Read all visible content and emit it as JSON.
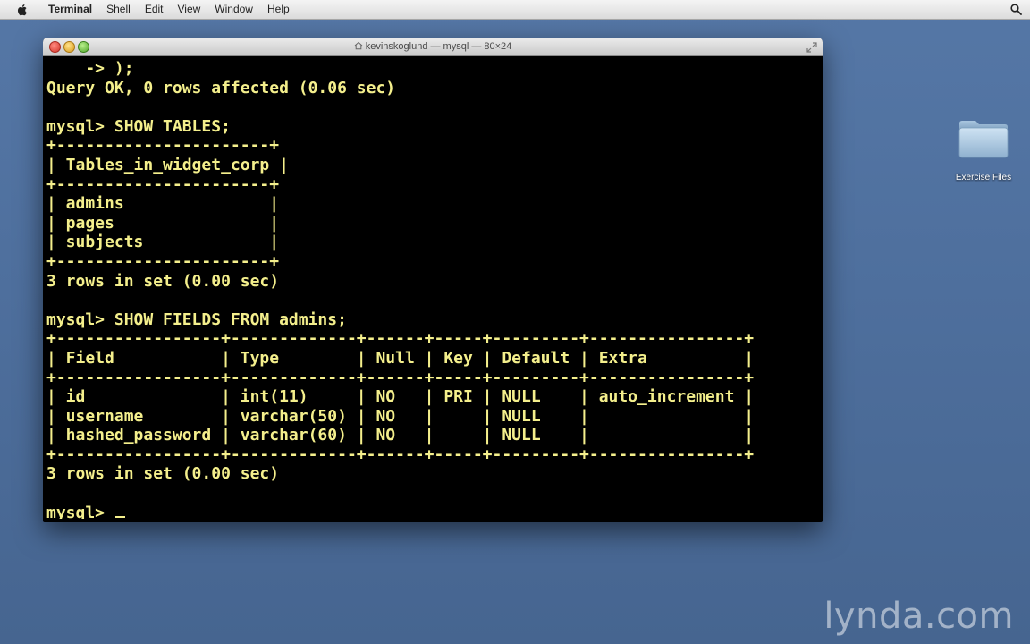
{
  "menubar": {
    "app": "Terminal",
    "items": [
      "Shell",
      "Edit",
      "View",
      "Window",
      "Help"
    ]
  },
  "window": {
    "title": "kevinskoglund — mysql — 80×24"
  },
  "terminal": {
    "lines": [
      "    -> );",
      "Query OK, 0 rows affected (0.06 sec)",
      "",
      "mysql> SHOW TABLES;",
      "+----------------------+",
      "| Tables_in_widget_corp |",
      "+----------------------+",
      "| admins               |",
      "| pages                |",
      "| subjects             |",
      "+----------------------+",
      "3 rows in set (0.00 sec)",
      "",
      "mysql> SHOW FIELDS FROM admins;",
      "+-----------------+-------------+------+-----+---------+----------------+",
      "| Field           | Type        | Null | Key | Default | Extra          |",
      "+-----------------+-------------+------+-----+---------+----------------+",
      "| id              | int(11)     | NO   | PRI | NULL    | auto_increment |",
      "| username        | varchar(50) | NO   |     | NULL    |                |",
      "| hashed_password | varchar(60) | NO   |     | NULL    |                |",
      "+-----------------+-------------+------+-----+---------+----------------+",
      "3 rows in set (0.00 sec)",
      ""
    ],
    "prompt": "mysql> ",
    "color": "#f4ef8c",
    "background": "#000000"
  },
  "desktop": {
    "icon_label": "Exercise Files",
    "icon": "folder-icon"
  },
  "watermark": "lynda.com"
}
